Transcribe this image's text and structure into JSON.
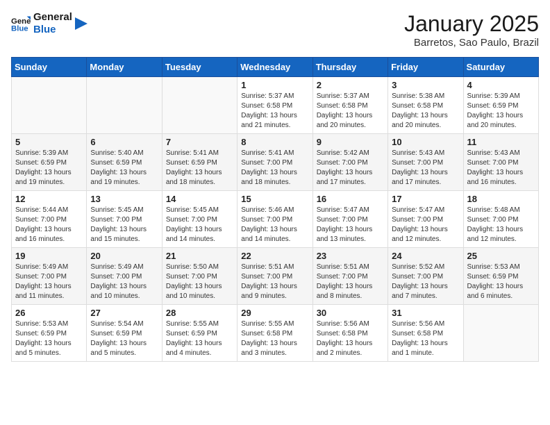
{
  "header": {
    "logo_line1": "General",
    "logo_line2": "Blue",
    "title": "January 2025",
    "subtitle": "Barretos, Sao Paulo, Brazil"
  },
  "days_of_week": [
    "Sunday",
    "Monday",
    "Tuesday",
    "Wednesday",
    "Thursday",
    "Friday",
    "Saturday"
  ],
  "weeks": [
    [
      {
        "day": "",
        "info": ""
      },
      {
        "day": "",
        "info": ""
      },
      {
        "day": "",
        "info": ""
      },
      {
        "day": "1",
        "info": "Sunrise: 5:37 AM\nSunset: 6:58 PM\nDaylight: 13 hours\nand 21 minutes."
      },
      {
        "day": "2",
        "info": "Sunrise: 5:37 AM\nSunset: 6:58 PM\nDaylight: 13 hours\nand 20 minutes."
      },
      {
        "day": "3",
        "info": "Sunrise: 5:38 AM\nSunset: 6:58 PM\nDaylight: 13 hours\nand 20 minutes."
      },
      {
        "day": "4",
        "info": "Sunrise: 5:39 AM\nSunset: 6:59 PM\nDaylight: 13 hours\nand 20 minutes."
      }
    ],
    [
      {
        "day": "5",
        "info": "Sunrise: 5:39 AM\nSunset: 6:59 PM\nDaylight: 13 hours\nand 19 minutes."
      },
      {
        "day": "6",
        "info": "Sunrise: 5:40 AM\nSunset: 6:59 PM\nDaylight: 13 hours\nand 19 minutes."
      },
      {
        "day": "7",
        "info": "Sunrise: 5:41 AM\nSunset: 6:59 PM\nDaylight: 13 hours\nand 18 minutes."
      },
      {
        "day": "8",
        "info": "Sunrise: 5:41 AM\nSunset: 7:00 PM\nDaylight: 13 hours\nand 18 minutes."
      },
      {
        "day": "9",
        "info": "Sunrise: 5:42 AM\nSunset: 7:00 PM\nDaylight: 13 hours\nand 17 minutes."
      },
      {
        "day": "10",
        "info": "Sunrise: 5:43 AM\nSunset: 7:00 PM\nDaylight: 13 hours\nand 17 minutes."
      },
      {
        "day": "11",
        "info": "Sunrise: 5:43 AM\nSunset: 7:00 PM\nDaylight: 13 hours\nand 16 minutes."
      }
    ],
    [
      {
        "day": "12",
        "info": "Sunrise: 5:44 AM\nSunset: 7:00 PM\nDaylight: 13 hours\nand 16 minutes."
      },
      {
        "day": "13",
        "info": "Sunrise: 5:45 AM\nSunset: 7:00 PM\nDaylight: 13 hours\nand 15 minutes."
      },
      {
        "day": "14",
        "info": "Sunrise: 5:45 AM\nSunset: 7:00 PM\nDaylight: 13 hours\nand 14 minutes."
      },
      {
        "day": "15",
        "info": "Sunrise: 5:46 AM\nSunset: 7:00 PM\nDaylight: 13 hours\nand 14 minutes."
      },
      {
        "day": "16",
        "info": "Sunrise: 5:47 AM\nSunset: 7:00 PM\nDaylight: 13 hours\nand 13 minutes."
      },
      {
        "day": "17",
        "info": "Sunrise: 5:47 AM\nSunset: 7:00 PM\nDaylight: 13 hours\nand 12 minutes."
      },
      {
        "day": "18",
        "info": "Sunrise: 5:48 AM\nSunset: 7:00 PM\nDaylight: 13 hours\nand 12 minutes."
      }
    ],
    [
      {
        "day": "19",
        "info": "Sunrise: 5:49 AM\nSunset: 7:00 PM\nDaylight: 13 hours\nand 11 minutes."
      },
      {
        "day": "20",
        "info": "Sunrise: 5:49 AM\nSunset: 7:00 PM\nDaylight: 13 hours\nand 10 minutes."
      },
      {
        "day": "21",
        "info": "Sunrise: 5:50 AM\nSunset: 7:00 PM\nDaylight: 13 hours\nand 10 minutes."
      },
      {
        "day": "22",
        "info": "Sunrise: 5:51 AM\nSunset: 7:00 PM\nDaylight: 13 hours\nand 9 minutes."
      },
      {
        "day": "23",
        "info": "Sunrise: 5:51 AM\nSunset: 7:00 PM\nDaylight: 13 hours\nand 8 minutes."
      },
      {
        "day": "24",
        "info": "Sunrise: 5:52 AM\nSunset: 7:00 PM\nDaylight: 13 hours\nand 7 minutes."
      },
      {
        "day": "25",
        "info": "Sunrise: 5:53 AM\nSunset: 6:59 PM\nDaylight: 13 hours\nand 6 minutes."
      }
    ],
    [
      {
        "day": "26",
        "info": "Sunrise: 5:53 AM\nSunset: 6:59 PM\nDaylight: 13 hours\nand 5 minutes."
      },
      {
        "day": "27",
        "info": "Sunrise: 5:54 AM\nSunset: 6:59 PM\nDaylight: 13 hours\nand 5 minutes."
      },
      {
        "day": "28",
        "info": "Sunrise: 5:55 AM\nSunset: 6:59 PM\nDaylight: 13 hours\nand 4 minutes."
      },
      {
        "day": "29",
        "info": "Sunrise: 5:55 AM\nSunset: 6:58 PM\nDaylight: 13 hours\nand 3 minutes."
      },
      {
        "day": "30",
        "info": "Sunrise: 5:56 AM\nSunset: 6:58 PM\nDaylight: 13 hours\nand 2 minutes."
      },
      {
        "day": "31",
        "info": "Sunrise: 5:56 AM\nSunset: 6:58 PM\nDaylight: 13 hours\nand 1 minute."
      },
      {
        "day": "",
        "info": ""
      }
    ]
  ]
}
